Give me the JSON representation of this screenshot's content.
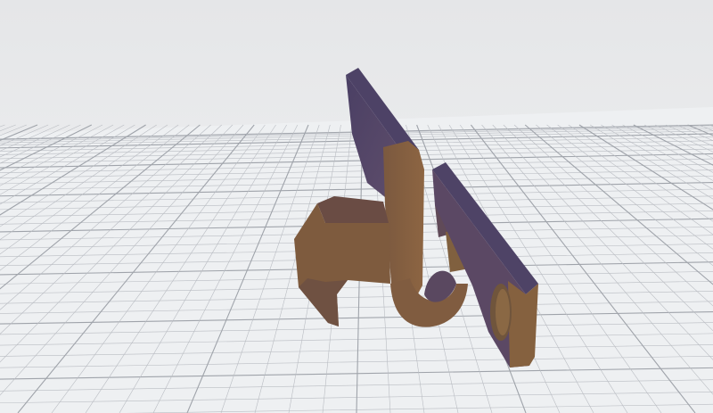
{
  "viewer": {
    "background_color": "#e8e9eb",
    "grid_line_color": "#b9bcc2",
    "grid_major_line_color": "#9fa3aa",
    "model": {
      "icon": "3d-model",
      "front_color": "#86603f",
      "side_color": "#51466a",
      "shade_color": "#6f5045"
    }
  }
}
